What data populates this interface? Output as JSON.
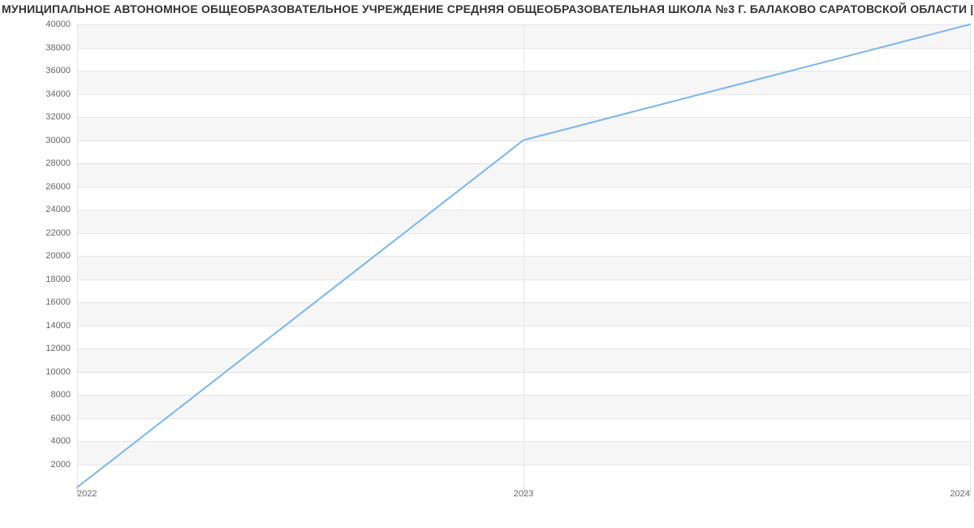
{
  "title": "МУНИЦИПАЛЬНОЕ АВТОНОМНОЕ ОБЩЕОБРАЗОВАТЕЛЬНОЕ УЧРЕЖДЕНИЕ СРЕДНЯЯ ОБЩЕОБРАЗОВАТЕЛЬНАЯ ШКОЛА №3 Г. БАЛАКОВО САРАТОВСКОЙ ОБЛАСТИ | Данные",
  "chart_data": {
    "type": "line",
    "x": [
      "2022",
      "2023",
      "2024"
    ],
    "series": [
      {
        "name": "",
        "values": [
          0,
          30000,
          40000
        ],
        "color": "#7cb5ec"
      }
    ],
    "title": "МУНИЦИПАЛЬНОЕ АВТОНОМНОЕ ОБЩЕОБРАЗОВАТЕЛЬНОЕ УЧРЕЖДЕНИЕ СРЕДНЯЯ ОБЩЕОБРАЗОВАТЕЛЬНАЯ ШКОЛА №3 Г. БАЛАКОВО САРАТОВСКОЙ ОБЛАСТИ | Данные",
    "xlabel": "",
    "ylabel": "",
    "ylim": [
      0,
      40000
    ],
    "y_ticks": [
      2000,
      4000,
      6000,
      8000,
      10000,
      12000,
      14000,
      16000,
      18000,
      20000,
      22000,
      24000,
      26000,
      28000,
      30000,
      32000,
      34000,
      36000,
      38000,
      40000
    ],
    "x_ticks": [
      "2022",
      "2023",
      "2024"
    ],
    "grid": true,
    "legend": false
  },
  "colors": {
    "band": "#f6f6f6",
    "grid": "#e6e6e6",
    "axis_text": "#666666",
    "line": "#7cb5ec"
  }
}
